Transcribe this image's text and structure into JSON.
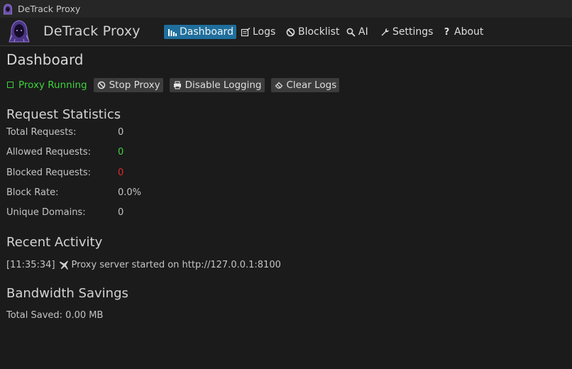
{
  "window": {
    "title": "DeTrack Proxy"
  },
  "header": {
    "app_title": "DeTrack Proxy",
    "nav": [
      {
        "label": "Dashboard",
        "icon": "bar-chart-icon",
        "active": true
      },
      {
        "label": "Logs",
        "icon": "logs-icon",
        "active": false
      },
      {
        "label": "Blocklist",
        "icon": "block-icon",
        "active": false
      },
      {
        "label": "AI",
        "icon": "search-icon",
        "active": false
      },
      {
        "label": "Settings",
        "icon": "wrench-icon",
        "active": false
      },
      {
        "label": "About",
        "icon": "question-icon",
        "active": false
      }
    ]
  },
  "dashboard": {
    "title": "Dashboard",
    "status": {
      "label": "Proxy Running",
      "color": "#3ed43e"
    },
    "buttons": {
      "stop": "Stop Proxy",
      "logging": "Disable Logging",
      "clear": "Clear Logs"
    }
  },
  "stats": {
    "title": "Request Statistics",
    "items": [
      {
        "label": "Total Requests:",
        "value": "0"
      },
      {
        "label": "Allowed Requests:",
        "value": "0",
        "color": "#3fd43f"
      },
      {
        "label": "Blocked Requests:",
        "value": "0",
        "color": "#e02a2a"
      },
      {
        "label": "Block Rate:",
        "value": "0.0%"
      },
      {
        "label": "Unique Domains:",
        "value": "0"
      }
    ]
  },
  "activity": {
    "title": "Recent Activity",
    "entries": [
      {
        "time": "[11:35:34]",
        "icon": "plane-icon",
        "message": "Proxy server started on http://127.0.0.1:8100"
      }
    ]
  },
  "bandwidth": {
    "title": "Bandwidth Savings",
    "total": "Total Saved: 0.00 MB"
  },
  "colors": {
    "accent": "#1f6f9d",
    "background": "#1b1b1b"
  }
}
